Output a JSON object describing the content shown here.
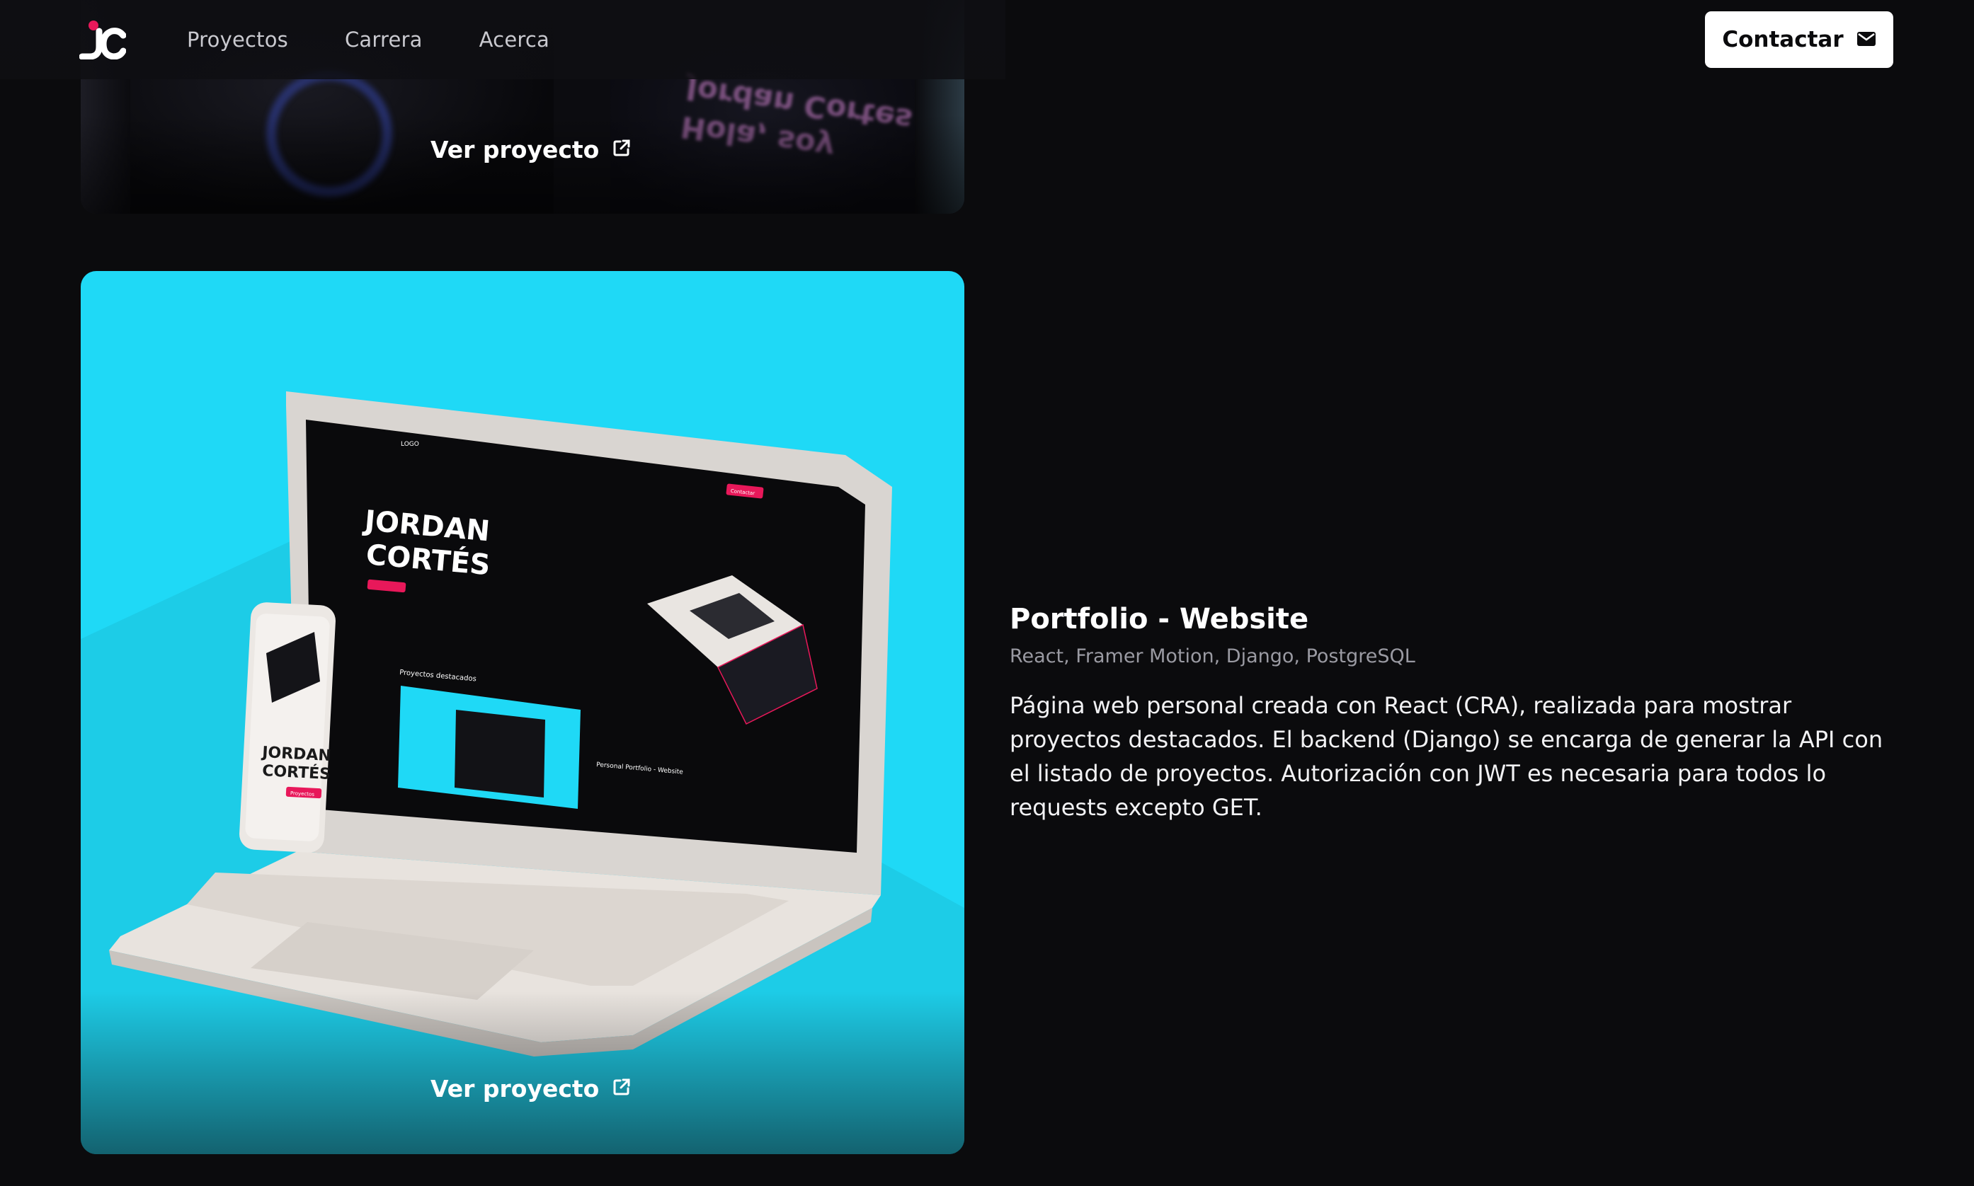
{
  "header": {
    "nav": [
      {
        "label": "Proyectos"
      },
      {
        "label": "Carrera"
      },
      {
        "label": "Acerca"
      }
    ],
    "contact_label": "Contactar",
    "logo_icon": "jc-logo-icon",
    "contact_icon": "mail-icon"
  },
  "previous_card": {
    "link_label": "Ver proyecto",
    "blurred_text": "Hola, soy\nJordan Cortes"
  },
  "project": {
    "link_label": "Ver proyecto",
    "title": "Portfolio - Website",
    "tech": "React, Framer Motion, Django, PostgreSQL",
    "description": "Página web personal creada con React (CRA), realizada para mostrar proyectos destacados. El backend (Django) se encarga de generar la API con el listado de proyectos. Autorización con JWT es necesaria para todos lo requests excepto GET.",
    "mockup": {
      "hero_line1": "JORDAN",
      "hero_line2": "CORTÉS",
      "phone_line1": "JORDAN",
      "phone_line2": "CORTÉS",
      "section_label": "Proyectos destacados",
      "card_title": "Personal Portfolio - Website",
      "cta_label": "Proyectos",
      "logo_text": "LOGO",
      "contact_btn": "Contactar"
    }
  },
  "colors": {
    "background": "#0b0b0d",
    "card_bg": "#1fd9f6",
    "accent": "#e8185a",
    "text_muted": "#9a9aa2"
  }
}
